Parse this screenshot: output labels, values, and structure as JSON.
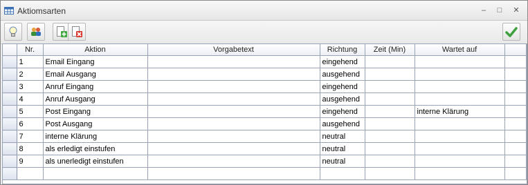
{
  "window": {
    "title": "Aktiomsarten",
    "minimize": "–",
    "maximize": "□",
    "close": "✕"
  },
  "toolbar": {
    "buttons": [
      {
        "icon": "lightbulb-icon"
      },
      {
        "icon": "refresh-people-icon"
      },
      {
        "icon": "add-record-icon"
      },
      {
        "icon": "delete-record-icon"
      },
      {
        "icon": "checkmark-icon"
      }
    ]
  },
  "grid": {
    "columns": [
      "Nr.",
      "Aktion",
      "Vorgabetext",
      "Richtung",
      "Zeit (Min)",
      "Wartet auf"
    ],
    "rows": [
      {
        "nr": "1",
        "aktion": "Email Eingang",
        "vorgabetext": "",
        "richtung": "eingehend",
        "zeit": "",
        "wartet": ""
      },
      {
        "nr": "2",
        "aktion": "Email Ausgang",
        "vorgabetext": "",
        "richtung": "ausgehend",
        "zeit": "",
        "wartet": ""
      },
      {
        "nr": "3",
        "aktion": "Anruf Eingang",
        "vorgabetext": "",
        "richtung": "eingehend",
        "zeit": "",
        "wartet": ""
      },
      {
        "nr": "4",
        "aktion": "Anruf Ausgang",
        "vorgabetext": "",
        "richtung": "ausgehend",
        "zeit": "",
        "wartet": ""
      },
      {
        "nr": "5",
        "aktion": "Post Eingang",
        "vorgabetext": "",
        "richtung": "eingehend",
        "zeit": "",
        "wartet": "interne Klärung"
      },
      {
        "nr": "6",
        "aktion": "Post Ausgang",
        "vorgabetext": "",
        "richtung": "ausgehend",
        "zeit": "",
        "wartet": ""
      },
      {
        "nr": "7",
        "aktion": "interne Klärung",
        "vorgabetext": "",
        "richtung": "neutral",
        "zeit": "",
        "wartet": ""
      },
      {
        "nr": "8",
        "aktion": "als erledigt einstufen",
        "vorgabetext": "",
        "richtung": "neutral",
        "zeit": "",
        "wartet": ""
      },
      {
        "nr": "9",
        "aktion": "als unerledigt einstufen",
        "vorgabetext": "",
        "richtung": "neutral",
        "zeit": "",
        "wartet": ""
      },
      {
        "nr": "",
        "aktion": "",
        "vorgabetext": "",
        "richtung": "",
        "zeit": "",
        "wartet": ""
      }
    ]
  }
}
